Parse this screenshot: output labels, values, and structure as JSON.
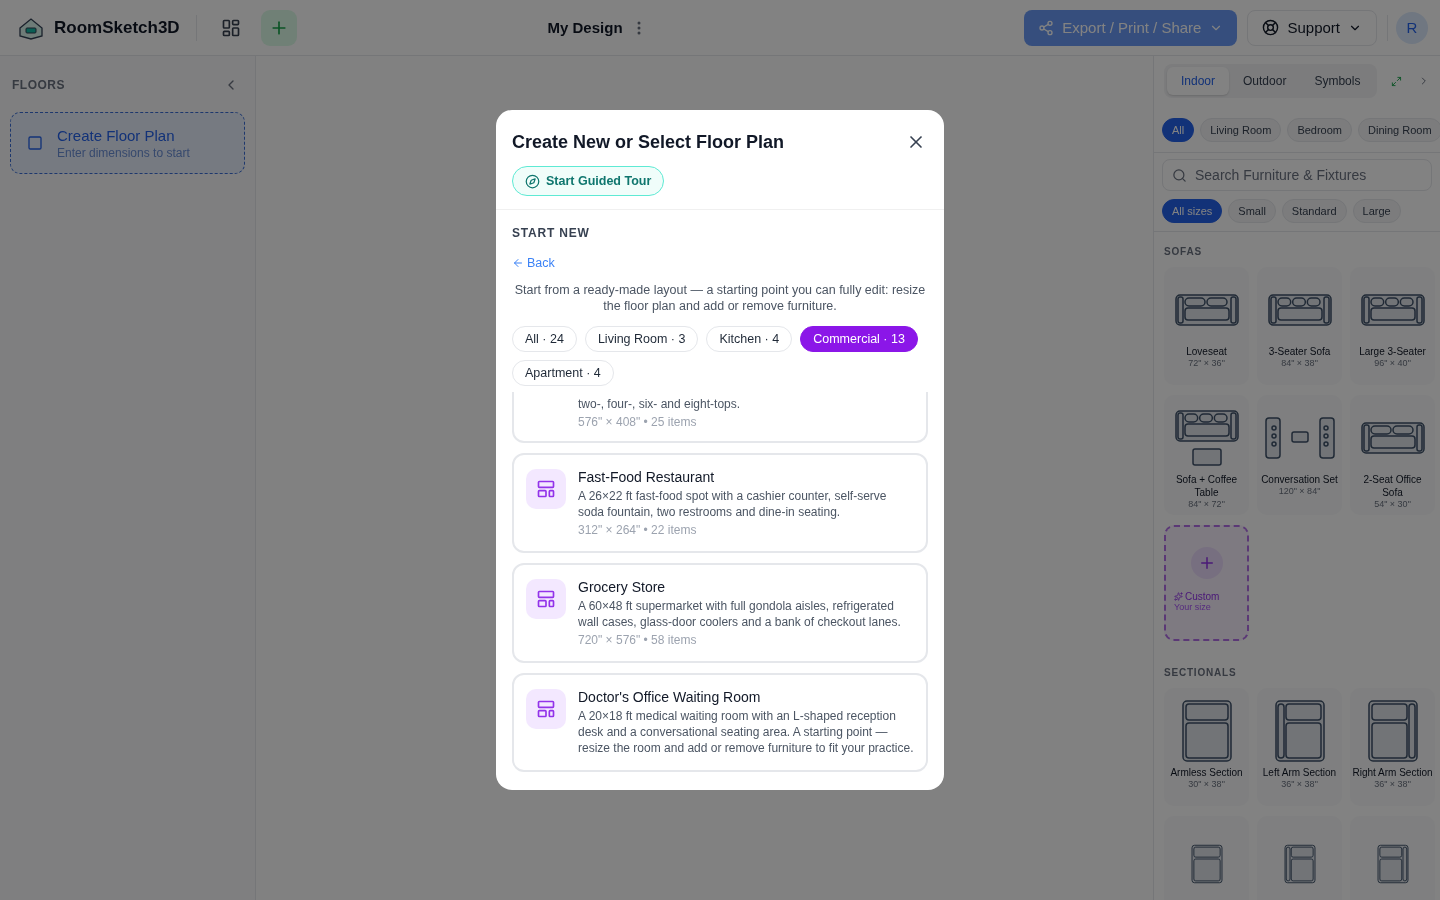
{
  "app_bar": {
    "brand": "RoomSketch3D",
    "design_title": "My Design",
    "export_button": "Export / Print / Share",
    "support_button": "Support",
    "avatar": "R"
  },
  "floors_panel": {
    "title": "FLOORS",
    "create_card": {
      "title": "Create Floor Plan",
      "subtitle": "Enter dimensions to start"
    }
  },
  "library": {
    "tabs": [
      {
        "label": "Indoor",
        "selected": true
      },
      {
        "label": "Outdoor",
        "selected": false
      },
      {
        "label": "Symbols",
        "selected": false
      }
    ],
    "categories": [
      {
        "label": "All",
        "selected": true
      },
      {
        "label": "Living Room",
        "selected": false
      },
      {
        "label": "Bedroom",
        "selected": false
      },
      {
        "label": "Dining Room",
        "selected": false
      }
    ],
    "search": {
      "placeholder": "Search Furniture & Fixtures"
    },
    "sizes": [
      {
        "label": "All sizes",
        "selected": true
      },
      {
        "label": "Small",
        "selected": false
      },
      {
        "label": "Standard",
        "selected": false
      },
      {
        "label": "Large",
        "selected": false
      }
    ],
    "sections": [
      {
        "title": "SOFAS",
        "items": [
          {
            "kind": "item",
            "name": "Loveseat",
            "dims": "72\" × 36\""
          },
          {
            "kind": "item",
            "name": "3-Seater Sofa",
            "dims": "84\" × 38\""
          },
          {
            "kind": "item",
            "name": "Large 3-Seater",
            "dims": "96\" × 40\""
          },
          {
            "kind": "item",
            "name": "Sofa + Coffee Table",
            "dims": "84\" × 72\""
          },
          {
            "kind": "item",
            "name": "Conversation Set",
            "dims": "120\" × 84\""
          },
          {
            "kind": "item",
            "name": "2-Seat Office Sofa",
            "dims": "54\" × 30\""
          },
          {
            "kind": "custom",
            "name": "Custom",
            "dims": "Your size"
          }
        ]
      },
      {
        "title": "SECTIONALS",
        "items": [
          {
            "kind": "item",
            "name": "Armless Section",
            "dims": "30\" × 38\""
          },
          {
            "kind": "item",
            "name": "Left Arm Section",
            "dims": "36\" × 38\""
          },
          {
            "kind": "item",
            "name": "Right Arm Section",
            "dims": "36\" × 38\""
          },
          {
            "kind": "cut"
          },
          {
            "kind": "cut"
          },
          {
            "kind": "cut"
          }
        ]
      }
    ]
  },
  "modal": {
    "title": "Create New or Select Floor Plan",
    "tour_button": "Start Guided Tour",
    "section_label": "START NEW",
    "back_link": "Back",
    "intro": "Start from a ready-made layout — a starting point you can fully edit: resize the floor plan and add or remove furniture.",
    "filters": [
      {
        "label": "All · 24",
        "selected": false
      },
      {
        "label": "Living Room · 3",
        "selected": false
      },
      {
        "label": "Kitchen · 4",
        "selected": false
      },
      {
        "label": "Commercial · 13",
        "selected": true
      },
      {
        "label": "Apartment · 4",
        "selected": false
      }
    ],
    "templates": [
      {
        "kind": "partial",
        "description": "two-, four-, six- and eight-tops.",
        "meta": "576\" × 408\" • 25 items"
      },
      {
        "kind": "full",
        "name": "Fast-Food Restaurant",
        "description": "A 26×22 ft fast-food spot with a cashier counter, self-serve soda fountain, two restrooms and dine-in seating.",
        "meta": "312\" × 264\" • 22 items"
      },
      {
        "kind": "full",
        "name": "Grocery Store",
        "description": "A 60×48 ft supermarket with full gondola aisles, refrigerated wall cases, glass-door coolers and a bank of checkout lanes.",
        "meta": "720\" × 576\" • 58 items"
      },
      {
        "kind": "full",
        "name": "Doctor's Office Waiting Room",
        "description": "A 20×18 ft medical waiting room with an L-shaped reception desk and a conversational seating area. A starting point — resize the room and add or remove furniture to fit your practice."
      }
    ]
  }
}
